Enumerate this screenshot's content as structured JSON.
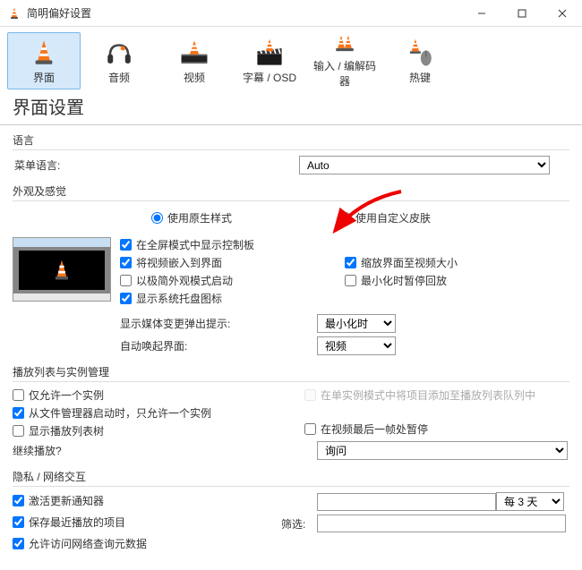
{
  "title": "简明偏好设置",
  "iconbar": {
    "items": [
      {
        "label": "界面"
      },
      {
        "label": "音频"
      },
      {
        "label": "视频"
      },
      {
        "label": "字幕  /  OSD"
      },
      {
        "label": "输入  /  编解码器"
      },
      {
        "label": "热键"
      }
    ]
  },
  "heading": "界面设置",
  "lang": {
    "title": "语言",
    "menu_label": "菜单语言:",
    "menu_value": "Auto"
  },
  "look": {
    "title": "外观及感觉",
    "native_style": "使用原生样式",
    "custom_skin": "使用自定义皮肤",
    "show_controls": "在全屏模式中显示控制板",
    "embed_video": "将视频嵌入到界面",
    "minimal_start": "以极简外观模式启动",
    "systray": "显示系统托盘图标",
    "resize_to_video": "缩放界面至视频大小",
    "pause_on_min": "最小化时暂停回放",
    "media_change_label": "显示媒体变更弹出提示:",
    "media_change_value": "最小化时",
    "auto_raise_label": "自动唤起界面:",
    "auto_raise_value": "视频"
  },
  "pl": {
    "title": "播放列表与实例管理",
    "one_instance": "仅允许一个实例",
    "enqueue": "在单实例模式中将项目添加至播放列表队列中",
    "from_fm": "从文件管理器启动时，只允许一个实例",
    "show_tree": "显示播放列表树",
    "pause_last": "在视频最后一帧处暂停",
    "continue_label": "继续播放?",
    "continue_value": "询问"
  },
  "priv": {
    "title": "隐私  /  网络交互",
    "update": "激活更新通知器",
    "every_label": "每 3 天",
    "save_recent": "保存最近播放的项目",
    "filter_label": "筛选:",
    "filter_value": "",
    "meta": "允许访问网络查询元数据"
  }
}
